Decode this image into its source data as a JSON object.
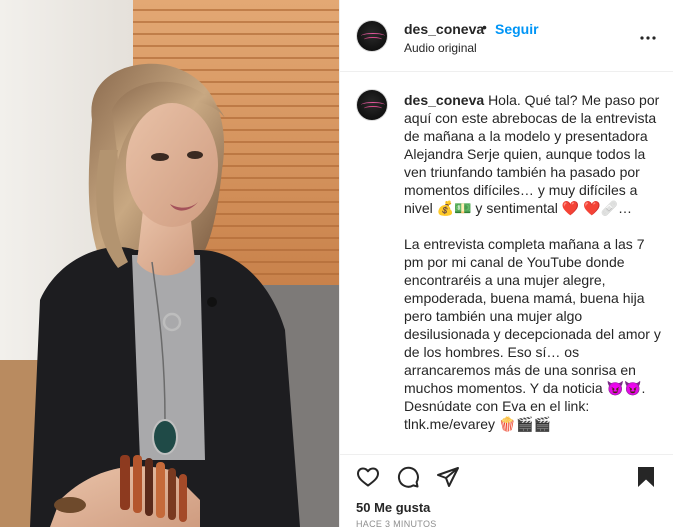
{
  "post": {
    "username": "des_coneva",
    "separator": "•",
    "follow_label": "Seguir",
    "audio_label": "Audio original",
    "caption": "Hola. Qué tal? Me paso por aquí con este abrebocas de la entrevista de mañana a la modelo y presentadora Alejandra Serje quien, aunque todos la ven triunfando también ha pasado por momentos difíciles… y muy difíciles a nivel 💰💵 y sentimental ❤️ ❤️🩹…\n\nLa entrevista completa mañana a las 7 pm por mi canal de YouTube donde encontraréis a una mujer alegre, empoderada, buena mamá, buena hija pero también una mujer algo desilusionada y decepcionada del amor y de los hombres. Eso sí… os arrancaremos más de una sonrisa en muchos momentos. Y da noticia 😈😈. Desnúdate con Eva en el link: tlnk.me/evarey 🍿🎬🎬",
    "likes": "50 Me gusta",
    "time_ago": "HACE 3 MINUTOS"
  },
  "icons": {
    "more": "more-horizontal-icon",
    "like": "heart-icon",
    "comment": "comment-bubble-icon",
    "share": "paper-plane-icon",
    "save": "bookmark-icon"
  }
}
